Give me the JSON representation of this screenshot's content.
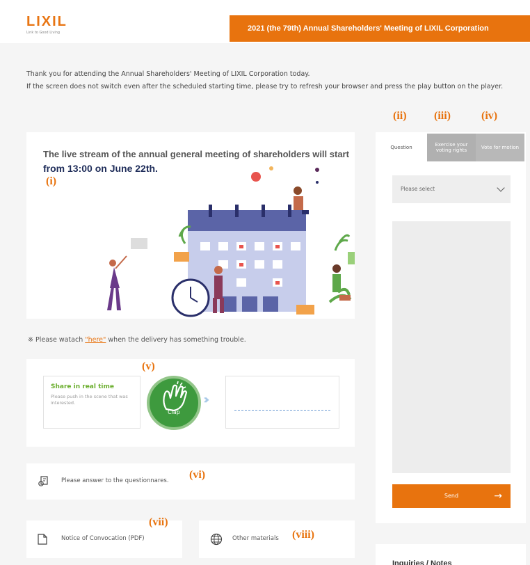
{
  "header": {
    "logo_text": "LIXIL",
    "logo_tagline": "Link to Good Living",
    "event_title": "2021 (the 79th) Annual Shareholders' Meeting of LIXIL Corporation"
  },
  "intro": {
    "line1": "Thank you for attending the Annual Shareholders' Meeting of LIXIL Corporation today.",
    "line2": "If the screen does not switch even after the scheduled starting time, please try to refresh your browser and press the play button on the player."
  },
  "video": {
    "message_prefix": "The live stream of the annual general meeting of shareholders will start ",
    "message_emph": "from 13:00 on June 22th."
  },
  "trouble": {
    "prefix": "※ Please watach ",
    "link": "\"here\"",
    "suffix": " when the delivery has something trouble."
  },
  "share": {
    "title": "Share in real time",
    "desc": "Please push in the scene that was interested.",
    "clap_label": "Clap"
  },
  "questionnaire": {
    "label": "Please answer to the questionnares."
  },
  "documents": {
    "notice": "Notice of Convocation (PDF)",
    "other": "Other materials"
  },
  "tabs": {
    "question": "Question",
    "exercise": "Exercise your voting rights",
    "vote": "Vote for motion"
  },
  "question_form": {
    "select_value": "Please select",
    "send_label": "Send"
  },
  "inquiries": {
    "title": "Inquiries / Notes"
  },
  "annotations": {
    "i": "(i)",
    "ii": "(ii)",
    "iii": "(iii)",
    "iv": "(iv)",
    "v": "(v)",
    "vi": "(vi)",
    "vii": "(vii)",
    "viii": "(viii)"
  },
  "colors": {
    "brand_orange": "#e8730e",
    "navy": "#1f2d5a",
    "clap_green": "#3e9a3e"
  },
  "icons": [
    "clap-icon",
    "questionnaire-icon",
    "pdf-document-icon",
    "globe-icon",
    "arrow-right-icon",
    "chevron-down-icon"
  ]
}
